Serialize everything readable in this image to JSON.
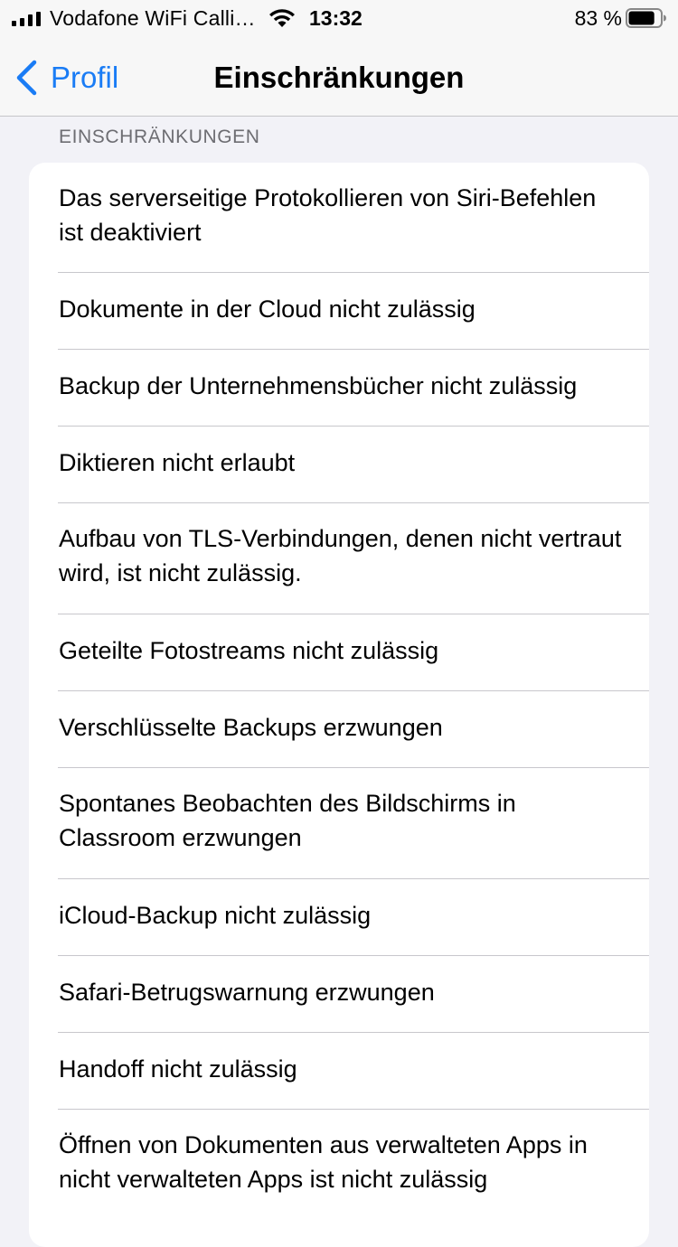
{
  "status_bar": {
    "carrier": "Vodafone WiFi Calli…",
    "time": "13:32",
    "battery_percent": "83 %",
    "battery_level": 0.83
  },
  "nav": {
    "back_label": "Profil",
    "title": "Einschränkungen"
  },
  "section": {
    "header": "EINSCHRÄNKUNGEN"
  },
  "restrictions": [
    {
      "label": "Das serverseitige Protokollieren von Siri-Befehlen ist deaktiviert"
    },
    {
      "label": "Dokumente in der Cloud nicht zulässig"
    },
    {
      "label": "Backup der Unternehmensbücher nicht zulässig"
    },
    {
      "label": "Diktieren nicht erlaubt"
    },
    {
      "label": "Aufbau von TLS-Verbindungen, denen nicht vertraut wird, ist nicht zulässig."
    },
    {
      "label": "Geteilte Fotostreams nicht zulässig"
    },
    {
      "label": "Verschlüsselte Backups erzwungen"
    },
    {
      "label": "Spontanes Beobachten des Bildschirms in Classroom erzwungen"
    },
    {
      "label": "iCloud-Backup nicht zulässig"
    },
    {
      "label": "Safari-Betrugswarnung erzwungen"
    },
    {
      "label": "Handoff nicht zulässig"
    },
    {
      "label": "Öffnen von Dokumenten aus verwalteten Apps in nicht verwalteten Apps ist nicht zulässig"
    }
  ],
  "colors": {
    "accent": "#1a7cf5",
    "background": "#f2f2f7",
    "separator": "#c8c7cc",
    "section_header": "#6d6d72"
  }
}
